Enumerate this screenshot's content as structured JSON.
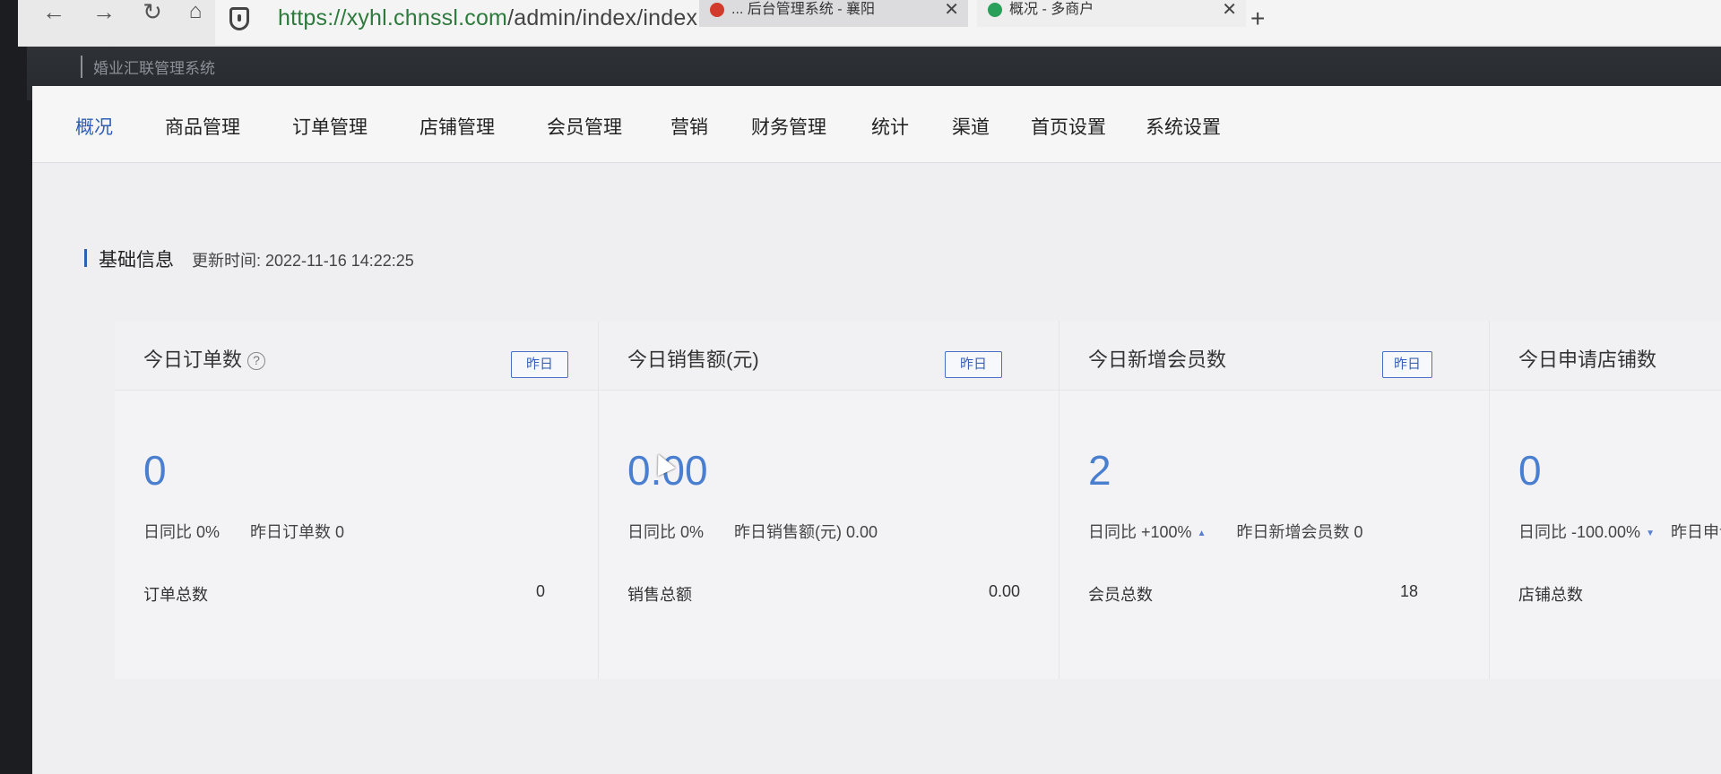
{
  "browser": {
    "tab1_title": "... 后台管理系统 - 襄阳",
    "tab2_title": "概况 - 多商户",
    "url_host": "https://xyhl.chnssl.com",
    "url_path": "/admin/index/index.html",
    "tab1_icon_color": "#d23b2b",
    "tab2_icon_color": "#2aa05a"
  },
  "app": {
    "title": "婚业汇联管理系统"
  },
  "menu": [
    {
      "label": "概况"
    },
    {
      "label": "商品管理"
    },
    {
      "label": "订单管理"
    },
    {
      "label": "店铺管理"
    },
    {
      "label": "会员管理"
    },
    {
      "label": "营销"
    },
    {
      "label": "财务管理"
    },
    {
      "label": "统计"
    },
    {
      "label": "渠道"
    },
    {
      "label": "首页设置"
    },
    {
      "label": "系统设置"
    }
  ],
  "section": {
    "title": "基础信息",
    "update_label": "更新时间: 2022-11-16 14:22:25"
  },
  "cards": [
    {
      "title": "今日订单数",
      "tag": "昨日",
      "value": "0",
      "ratio": "日同比 0%",
      "yesterday": "昨日订单数 0",
      "total_label": "订单总数",
      "total_value": "0"
    },
    {
      "title": "今日销售额(元)",
      "tag": "昨日",
      "value": "0.00",
      "ratio": "日同比 0%",
      "yesterday": "昨日销售额(元) 0.00",
      "total_label": "销售总额",
      "total_value": "0.00"
    },
    {
      "title": "今日新增会员数",
      "tag": "昨日",
      "value": "2",
      "ratio": "日同比 +100%",
      "yesterday": "昨日新增会员数 0",
      "total_label": "会员总数",
      "total_value": "18"
    },
    {
      "title": "今日申请店铺数",
      "value": "0",
      "ratio": "日同比 -100.00%",
      "yesterday": "昨日申请",
      "total_label": "店铺总数",
      "total_value": ""
    }
  ],
  "colors": {
    "accent": "#2f5fb3",
    "number": "#4a7fd0",
    "url_green": "#2d7a3c"
  }
}
